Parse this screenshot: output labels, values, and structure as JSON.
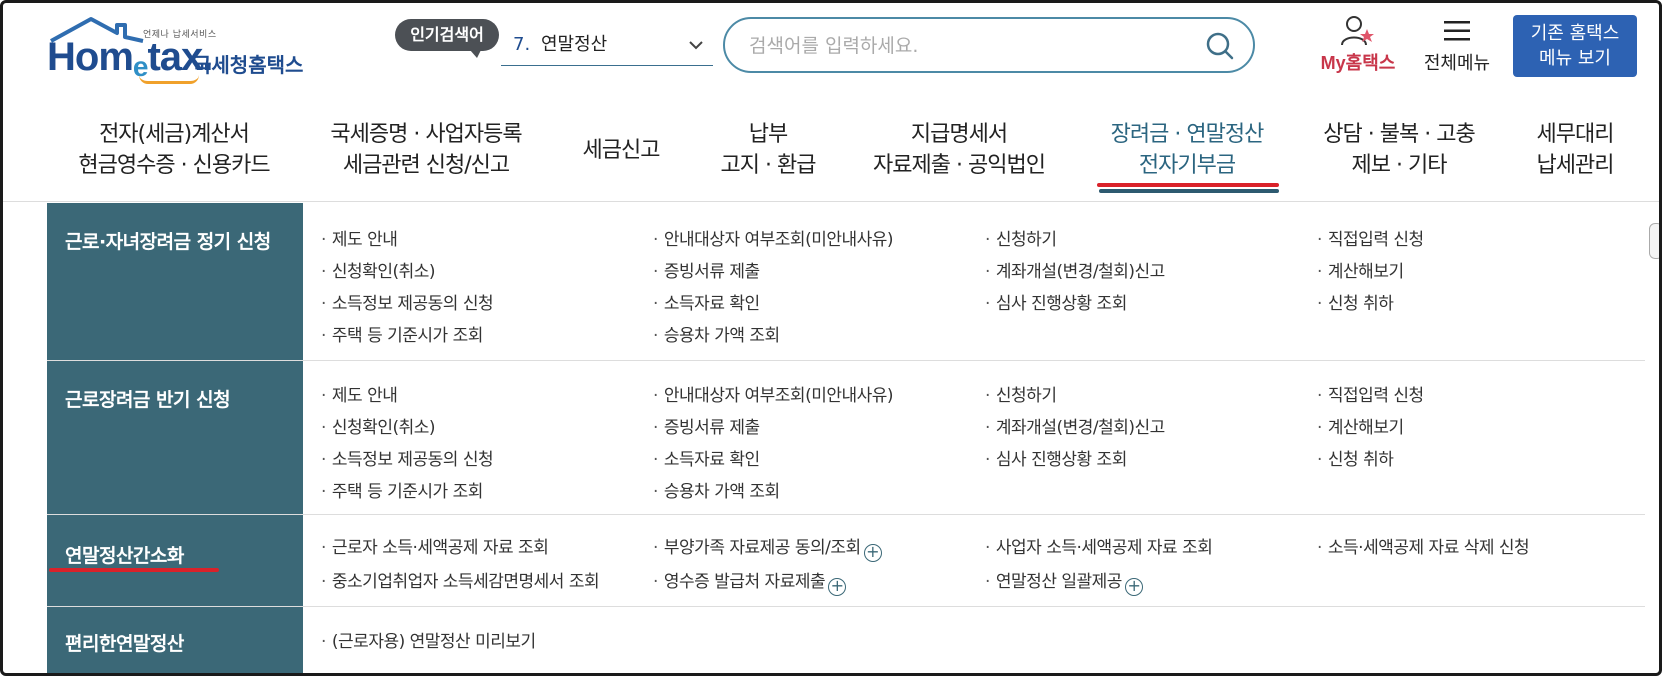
{
  "header": {
    "logo_tagline": "언제나 납세서비스",
    "logo_word_a": "Hom",
    "logo_word_e": "e",
    "logo_word_b": "tax.",
    "logo_kr": "국세청홈택스",
    "popular_badge": "인기검색어",
    "popular_num": "7.",
    "popular_term": "연말정산",
    "search_placeholder": "검색어를 입력하세요.",
    "my_hometax_a": "My",
    "my_hometax_b": "홈택스",
    "all_menu": "전체메뉴",
    "old_menu_l1": "기존 홈택스",
    "old_menu_l2": "메뉴 보기"
  },
  "gnb": [
    {
      "l1": "전자(세금)계산서",
      "l2": "현금영수증 · 신용카드"
    },
    {
      "l1": "국세증명 · 사업자등록",
      "l2": "세금관련 신청/신고"
    },
    {
      "l1": "세금신고",
      "l2": ""
    },
    {
      "l1": "납부",
      "l2": "고지 · 환급"
    },
    {
      "l1": "지급명세서",
      "l2": "자료제출 · 공익법인"
    },
    {
      "l1": "장려금 · 연말정산",
      "l2": "전자기부금"
    },
    {
      "l1": "상담 · 불복 · 고충",
      "l2": "제보 · 기타"
    },
    {
      "l1": "세무대리",
      "l2": "납세관리"
    }
  ],
  "rows": [
    {
      "title": "근로·자녀장려금 정기 신청",
      "cols": [
        [
          "제도 안내",
          "신청확인(취소)",
          "소득정보 제공동의 신청",
          "주택 등 기준시가 조회"
        ],
        [
          "안내대상자 여부조회(미안내사유)",
          "증빙서류 제출",
          "소득자료 확인",
          "승용차 가액 조회"
        ],
        [
          "신청하기",
          "계좌개설(변경/철회)신고",
          "심사 진행상황 조회"
        ],
        [
          "직접입력 신청",
          "계산해보기",
          "신청 취하"
        ]
      ]
    },
    {
      "title": "근로장려금 반기 신청",
      "cols": [
        [
          "제도 안내",
          "신청확인(취소)",
          "소득정보 제공동의 신청",
          "주택 등 기준시가 조회"
        ],
        [
          "안내대상자 여부조회(미안내사유)",
          "증빙서류 제출",
          "소득자료 확인",
          "승용차 가액 조회"
        ],
        [
          "신청하기",
          "계좌개설(변경/철회)신고",
          "심사 진행상황 조회"
        ],
        [
          "직접입력 신청",
          "계산해보기",
          "신청 취하"
        ]
      ]
    },
    {
      "title": "연말정산간소화",
      "cols": [
        [
          "근로자 소득·세액공제 자료 조회",
          "중소기업취업자 소득세감면명세서 조회"
        ],
        [
          "부양가족 자료제공 동의/조회",
          "영수증 발급처 자료제출"
        ],
        [
          "사업자 소득·세액공제 자료 조회",
          "연말정산 일괄제공"
        ],
        [
          "소득·세액공제 자료 삭제 신청"
        ]
      ]
    },
    {
      "title": "편리한연말정산",
      "cols": [
        [
          "(근로자용) 연말정산 미리보기"
        ]
      ]
    }
  ]
}
